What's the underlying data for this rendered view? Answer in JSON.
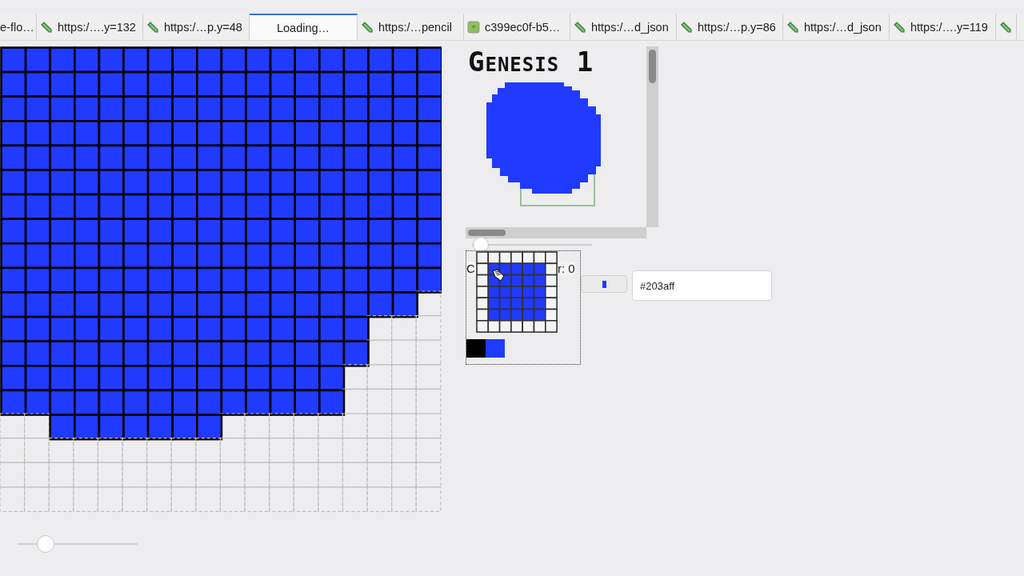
{
  "tabs": [
    {
      "label": "e-flo…",
      "kind": "plain",
      "selected": false
    },
    {
      "label": "https:/….y=132",
      "kind": "pencil",
      "selected": false
    },
    {
      "label": "https:/…p.y=48",
      "kind": "pencil",
      "selected": false
    },
    {
      "label": "Loading…",
      "kind": "plain",
      "selected": true
    },
    {
      "label": "https:/…pencil",
      "kind": "pencil",
      "selected": false
    },
    {
      "label": "c399ec0f-b5…",
      "kind": "image",
      "selected": false
    },
    {
      "label": "https:/…d_json",
      "kind": "pencil",
      "selected": false
    },
    {
      "label": "https:/…p.y=86",
      "kind": "pencil",
      "selected": false
    },
    {
      "label": "https:/…d_json",
      "kind": "pencil",
      "selected": false
    },
    {
      "label": "https:/….y=119",
      "kind": "pencil",
      "selected": false
    },
    {
      "kind": "pencil",
      "selected": false
    }
  ],
  "canvas": {
    "rows": [
      {
        "filled": [
          true,
          true,
          true,
          true,
          true,
          true,
          true,
          true,
          true,
          true,
          true,
          true,
          true,
          true,
          true,
          true,
          true,
          true
        ]
      },
      {
        "filled": [
          true,
          true,
          true,
          true,
          true,
          true,
          true,
          true,
          true,
          true,
          true,
          true,
          true,
          true,
          true,
          true,
          true,
          true
        ]
      },
      {
        "filled": [
          true,
          true,
          true,
          true,
          true,
          true,
          true,
          true,
          true,
          true,
          true,
          true,
          true,
          true,
          true,
          true,
          true,
          true
        ]
      },
      {
        "filled": [
          true,
          true,
          true,
          true,
          true,
          true,
          true,
          true,
          true,
          true,
          true,
          true,
          true,
          true,
          true,
          true,
          true,
          true
        ]
      },
      {
        "filled": [
          true,
          true,
          true,
          true,
          true,
          true,
          true,
          true,
          true,
          true,
          true,
          true,
          true,
          true,
          true,
          true,
          true,
          true
        ]
      },
      {
        "filled": [
          true,
          true,
          true,
          true,
          true,
          true,
          true,
          true,
          true,
          true,
          true,
          true,
          true,
          true,
          true,
          true,
          true,
          true
        ]
      },
      {
        "filled": [
          true,
          true,
          true,
          true,
          true,
          true,
          true,
          true,
          true,
          true,
          true,
          true,
          true,
          true,
          true,
          true,
          true,
          true
        ]
      },
      {
        "filled": [
          true,
          true,
          true,
          true,
          true,
          true,
          true,
          true,
          true,
          true,
          true,
          true,
          true,
          true,
          true,
          true,
          true,
          true
        ]
      },
      {
        "filled": [
          true,
          true,
          true,
          true,
          true,
          true,
          true,
          true,
          true,
          true,
          true,
          true,
          true,
          true,
          true,
          true,
          true,
          true
        ]
      },
      {
        "filled": [
          true,
          true,
          true,
          true,
          true,
          true,
          true,
          true,
          true,
          true,
          true,
          true,
          true,
          true,
          true,
          true,
          true,
          true
        ]
      },
      {
        "filled": [
          true,
          true,
          true,
          true,
          true,
          true,
          true,
          true,
          true,
          true,
          true,
          true,
          true,
          true,
          true,
          true,
          true,
          false
        ]
      },
      {
        "filled": [
          true,
          true,
          true,
          true,
          true,
          true,
          true,
          true,
          true,
          true,
          true,
          true,
          true,
          true,
          true,
          false,
          false,
          false
        ]
      },
      {
        "filled": [
          true,
          true,
          true,
          true,
          true,
          true,
          true,
          true,
          true,
          true,
          true,
          true,
          true,
          true,
          true,
          false,
          false,
          false
        ]
      },
      {
        "filled": [
          true,
          true,
          true,
          true,
          true,
          true,
          true,
          true,
          true,
          true,
          true,
          true,
          true,
          true,
          false,
          false,
          false,
          false
        ]
      },
      {
        "filled": [
          true,
          true,
          true,
          true,
          true,
          true,
          true,
          true,
          true,
          true,
          true,
          true,
          true,
          true,
          false,
          false,
          false,
          false
        ]
      },
      {
        "filled": [
          false,
          false,
          true,
          true,
          true,
          true,
          true,
          true,
          true,
          false,
          false,
          false,
          false,
          false,
          false,
          false,
          false,
          false
        ]
      },
      {
        "filled": [
          false,
          false,
          false,
          false,
          false,
          false,
          false,
          false,
          false,
          false,
          false,
          false,
          false,
          false,
          false,
          false,
          false,
          false
        ]
      },
      {
        "filled": [
          false,
          false,
          false,
          false,
          false,
          false,
          false,
          false,
          false,
          false,
          false,
          false,
          false,
          false,
          false,
          false,
          false,
          false
        ]
      },
      {
        "filled": [
          false,
          false,
          false,
          false,
          false,
          false,
          false,
          false,
          false,
          false,
          false,
          false,
          false,
          false,
          false,
          false,
          false,
          false
        ]
      }
    ]
  },
  "zoom_slider": {
    "level": 0.23
  },
  "preview": {
    "title": "Genesis 1"
  },
  "preview_slider": {
    "level": 0.07
  },
  "mini_grid": {
    "rows": [
      {
        "filled": [
          false,
          false,
          false,
          false,
          false,
          false,
          false
        ]
      },
      {
        "filled": [
          false,
          true,
          true,
          true,
          true,
          true,
          false
        ]
      },
      {
        "filled": [
          false,
          true,
          true,
          true,
          true,
          true,
          false
        ]
      },
      {
        "filled": [
          false,
          true,
          true,
          true,
          true,
          true,
          false
        ]
      },
      {
        "filled": [
          false,
          true,
          true,
          true,
          true,
          true,
          false
        ]
      },
      {
        "filled": [
          false,
          true,
          true,
          true,
          true,
          true,
          false
        ]
      },
      {
        "filled": [
          false,
          false,
          false,
          false,
          false,
          false,
          false
        ]
      }
    ]
  },
  "overlay_texts": [
    "C",
    "r: 0"
  ],
  "palette": [
    {
      "color": "#000000"
    },
    {
      "color": "#203aff"
    }
  ],
  "color_field": {
    "value": "#203aff"
  }
}
